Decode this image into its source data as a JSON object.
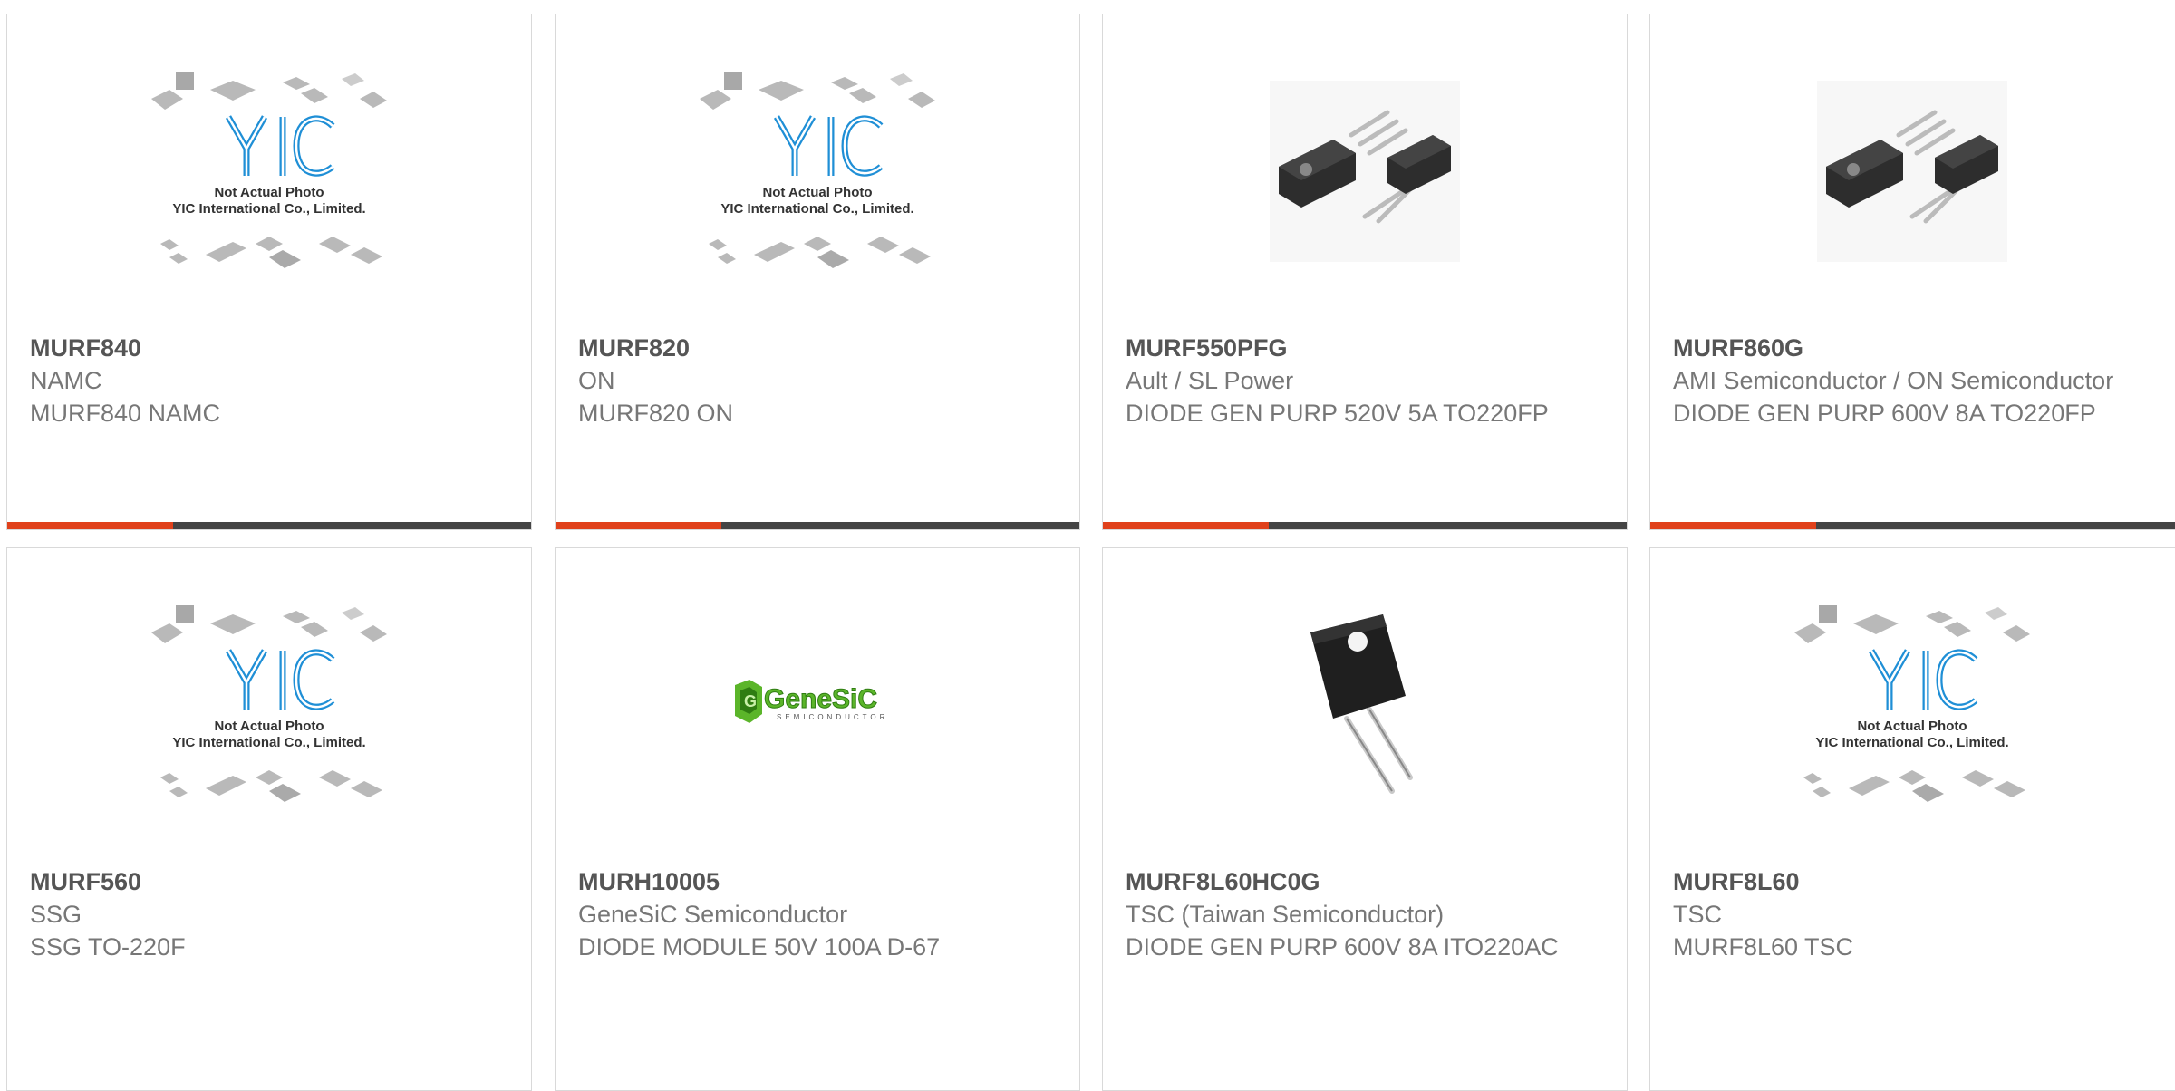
{
  "colors": {
    "accent": "#e0411b",
    "bar": "#444444",
    "border": "#d9d9d9",
    "yic_blue": "#1f8fd6",
    "genesic_green": "#5bb52a"
  },
  "placeholder": {
    "line1": "Not Actual Photo",
    "line2": "YIC International Co., Limited."
  },
  "products": [
    {
      "part": "MURF840",
      "manufacturer": "NAMC",
      "description": "MURF840 NAMC",
      "image": "yic-placeholder-icon"
    },
    {
      "part": "MURF820",
      "manufacturer": "ON",
      "description": "MURF820 ON",
      "image": "yic-placeholder-icon"
    },
    {
      "part": "MURF550PFG",
      "manufacturer": "Ault / SL Power",
      "description": "DIODE GEN PURP 520V 5A TO220FP",
      "image": "to220fp-photo-icon"
    },
    {
      "part": "MURF860G",
      "manufacturer": "AMI Semiconductor / ON Semiconductor",
      "description": "DIODE GEN PURP 600V 8A TO220FP",
      "image": "to220fp-photo-icon"
    },
    {
      "part": "MURF560",
      "manufacturer": "SSG",
      "description": "SSG TO-220F",
      "image": "yic-placeholder-icon"
    },
    {
      "part": "MURH10005",
      "manufacturer": "GeneSiC Semiconductor",
      "description": "DIODE MODULE 50V 100A D-67",
      "image": "genesic-logo-icon"
    },
    {
      "part": "MURF8L60HC0G",
      "manufacturer": "TSC (Taiwan Semiconductor)",
      "description": "DIODE GEN PURP 600V 8A ITO220AC",
      "image": "ito220ac-photo-icon"
    },
    {
      "part": "MURF8L60",
      "manufacturer": "TSC",
      "description": "MURF8L60 TSC",
      "image": "yic-placeholder-icon"
    }
  ],
  "genesic": {
    "name": "GeneSiC",
    "tagline": "SEMICONDUCTOR"
  }
}
